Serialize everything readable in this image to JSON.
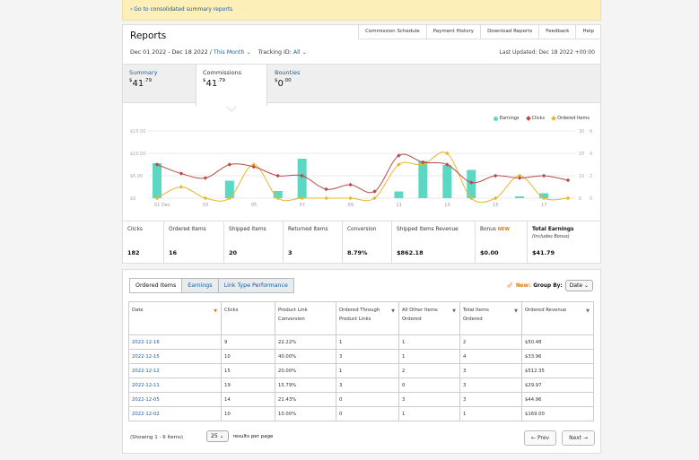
{
  "banner": {
    "link": "‹ Go to consolidated summary reports"
  },
  "reports": {
    "title": "Reports",
    "tabs": [
      "Commission Schedule",
      "Payment History",
      "Download Reports",
      "Feedback",
      "Help"
    ],
    "date_range": "Dec 01 2022 - Dec 18 2022 /",
    "period": "This Month ⌄",
    "tracking_label": "Tracking ID:",
    "tracking_value": "All ⌄",
    "last_updated": "Last Updated: Dec 18 2022 +00:00"
  },
  "metrics": [
    {
      "label": "Summary",
      "currency": "$",
      "whole": "41",
      "cents": ".79"
    },
    {
      "label": "Commissions",
      "currency": "$",
      "whole": "41",
      "cents": ".79"
    },
    {
      "label": "Bounties",
      "currency": "$",
      "whole": "0",
      "cents": ".00"
    }
  ],
  "chart_data": {
    "type": "bar",
    "legend": [
      "Earnings",
      "Clicks",
      "Ordered Items"
    ],
    "colors": {
      "earnings": "#5bd8c3",
      "clicks": "#b94a48",
      "ordered": "#e8b531"
    },
    "x_ticks": [
      "01 Dec",
      "03",
      "05",
      "07",
      "09",
      "11",
      "13",
      "15",
      "17"
    ],
    "y_left_ticks": [
      "$15.00",
      "$10.00",
      "$5.00",
      "$0"
    ],
    "y_mid_ticks": [
      "30",
      "20",
      "10",
      "0"
    ],
    "y_right_ticks": [
      "6",
      "4",
      "2",
      "0"
    ],
    "days": [
      1,
      2,
      3,
      4,
      5,
      6,
      7,
      8,
      9,
      10,
      11,
      12,
      13,
      14,
      15,
      16,
      17,
      18
    ],
    "earnings": [
      7.8,
      0,
      0,
      3.9,
      0,
      1.6,
      8.8,
      0,
      0,
      0,
      1.5,
      8.3,
      7.4,
      6.3,
      0,
      0.4,
      1.1,
      0
    ],
    "clicks": [
      15,
      11,
      9,
      15,
      14,
      10,
      10,
      4,
      6,
      3,
      19,
      16,
      15,
      7,
      10,
      9,
      10,
      8
    ],
    "ordered_items": [
      0,
      1,
      0,
      0,
      3,
      0,
      0,
      0,
      0,
      0,
      3,
      3,
      4,
      0,
      0,
      2,
      0,
      0
    ]
  },
  "stats": [
    {
      "label": "Clicks",
      "value": "182"
    },
    {
      "label": "Ordered Items",
      "value": "16"
    },
    {
      "label": "Shipped Items",
      "value": "20"
    },
    {
      "label": "Returned Items",
      "value": "3"
    },
    {
      "label": "Conversion",
      "value": "8.79%"
    },
    {
      "label": "Shipped Items Revenue",
      "value": "$862.18"
    },
    {
      "label": "Bonus",
      "badge": "NEW",
      "value": "$0.00"
    },
    {
      "label": "Total Earnings",
      "sub": "(Includes Bonus)",
      "value": "$41.79"
    }
  ],
  "orders": {
    "tabs": [
      "Ordered Items",
      "Earnings",
      "Link Type Performance"
    ],
    "group_new": "New:",
    "group_label": "Group By:",
    "group_value": "Date",
    "columns": [
      "Date",
      "Clicks",
      "Product Link Conversion",
      "Ordered Through Product Links",
      "All Other Items Ordered",
      "Total Items Ordered",
      "Ordered Revenue"
    ],
    "rows": [
      [
        "2022-12-16",
        "9",
        "22.22%",
        "1",
        "1",
        "2",
        "$50.48"
      ],
      [
        "2022-12-15",
        "10",
        "40.00%",
        "3",
        "1",
        "4",
        "$33.96"
      ],
      [
        "2022-12-12",
        "15",
        "20.00%",
        "1",
        "2",
        "3",
        "$512.35"
      ],
      [
        "2022-12-11",
        "19",
        "15.79%",
        "3",
        "0",
        "3",
        "$29.97"
      ],
      [
        "2022-12-05",
        "14",
        "21.43%",
        "0",
        "3",
        "3",
        "$44.96"
      ],
      [
        "2022-12-02",
        "10",
        "10.00%",
        "0",
        "1",
        "1",
        "$169.00"
      ]
    ],
    "showing": "(Showing 1 - 6 Items)",
    "per_page": "25 ⌄",
    "per_page_label": "results per page",
    "prev": "← Prev",
    "next": "Next →"
  }
}
